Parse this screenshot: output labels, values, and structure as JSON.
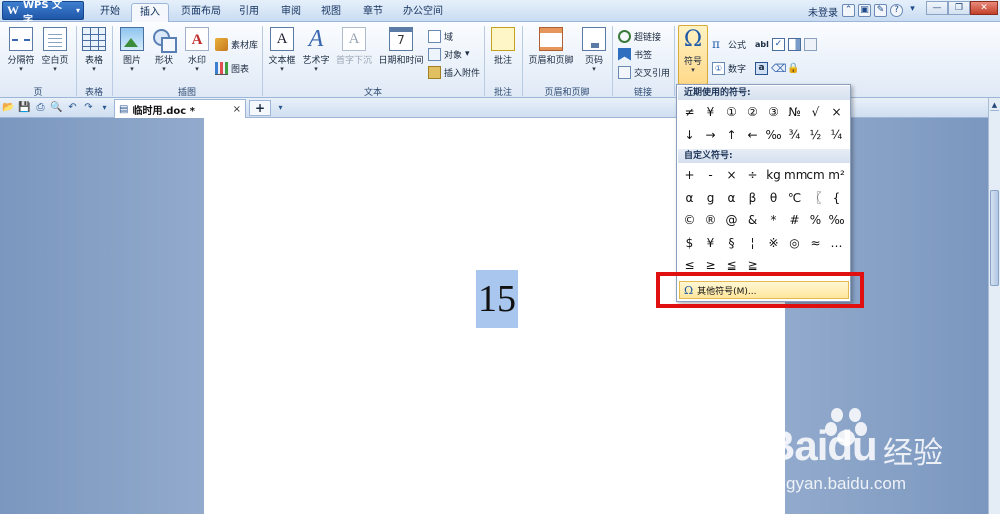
{
  "app": {
    "name": "WPS 文字",
    "logo": "W"
  },
  "menu": {
    "tabs": [
      {
        "label": "开始"
      },
      {
        "label": "插入"
      },
      {
        "label": "页面布局"
      },
      {
        "label": "引用"
      },
      {
        "label": "审阅"
      },
      {
        "label": "视图"
      },
      {
        "label": "章节"
      },
      {
        "label": "办公空间"
      }
    ],
    "active": "插入",
    "login_label": "未登录"
  },
  "ribbon": {
    "groups": [
      {
        "label": "页"
      },
      {
        "label": "表格"
      },
      {
        "label": "插图"
      },
      {
        "label": "文本"
      },
      {
        "label": "批注"
      },
      {
        "label": "页眉和页脚"
      },
      {
        "label": "链接"
      }
    ],
    "buttons": {
      "page_break": "分隔符",
      "blank_page": "空白页",
      "table": "表格",
      "picture": "图片",
      "shape": "形状",
      "watermark": "水印",
      "material": "素材库",
      "chart": "图表",
      "textbox": "文本框",
      "wordart": "艺术字",
      "first_char_drop": "首字下沉",
      "datetime": "日期和时间",
      "field": "域",
      "object": "对象",
      "attachment": "插入附件",
      "comment": "批注",
      "header_footer": "页眉和页脚",
      "page_number": "页码",
      "hyperlink": "超链接",
      "bookmark": "书签",
      "cross_ref": "交叉引用",
      "symbol": "符号",
      "formula": "公式",
      "number": "数字",
      "abl": "abl"
    }
  },
  "document": {
    "tab_title": "临时用.doc *",
    "close_glyph": "×",
    "new_tab_glyph": "+",
    "selected_text": "15"
  },
  "symbol_panel": {
    "recent_label": "近期使用的符号:",
    "recent_symbols": [
      "≠",
      "¥",
      "①",
      "②",
      "③",
      "№",
      "√",
      "×",
      "↓",
      "→",
      "↑",
      "←",
      "‰",
      "¾",
      "½",
      "¼"
    ],
    "custom_label": "自定义符号:",
    "custom_symbols": [
      "+",
      "-",
      "×",
      "÷",
      "kg",
      "mm",
      "cm",
      "m²",
      "α",
      "g",
      "α",
      "β",
      "θ",
      "℃",
      "〖",
      "{",
      "©",
      "®",
      "@",
      "&",
      "*",
      "#",
      "%",
      "‰",
      "$",
      "¥",
      "§",
      "¦",
      "※",
      "◎",
      "≈",
      "…",
      "≤",
      "≥",
      "≦",
      "≧"
    ],
    "more_label": "其他符号(M)...",
    "highlight_color": "#e01010"
  },
  "watermark": {
    "brand": "Baidu",
    "brand_cn": "经验",
    "url": "jingyan.baidu.com"
  }
}
